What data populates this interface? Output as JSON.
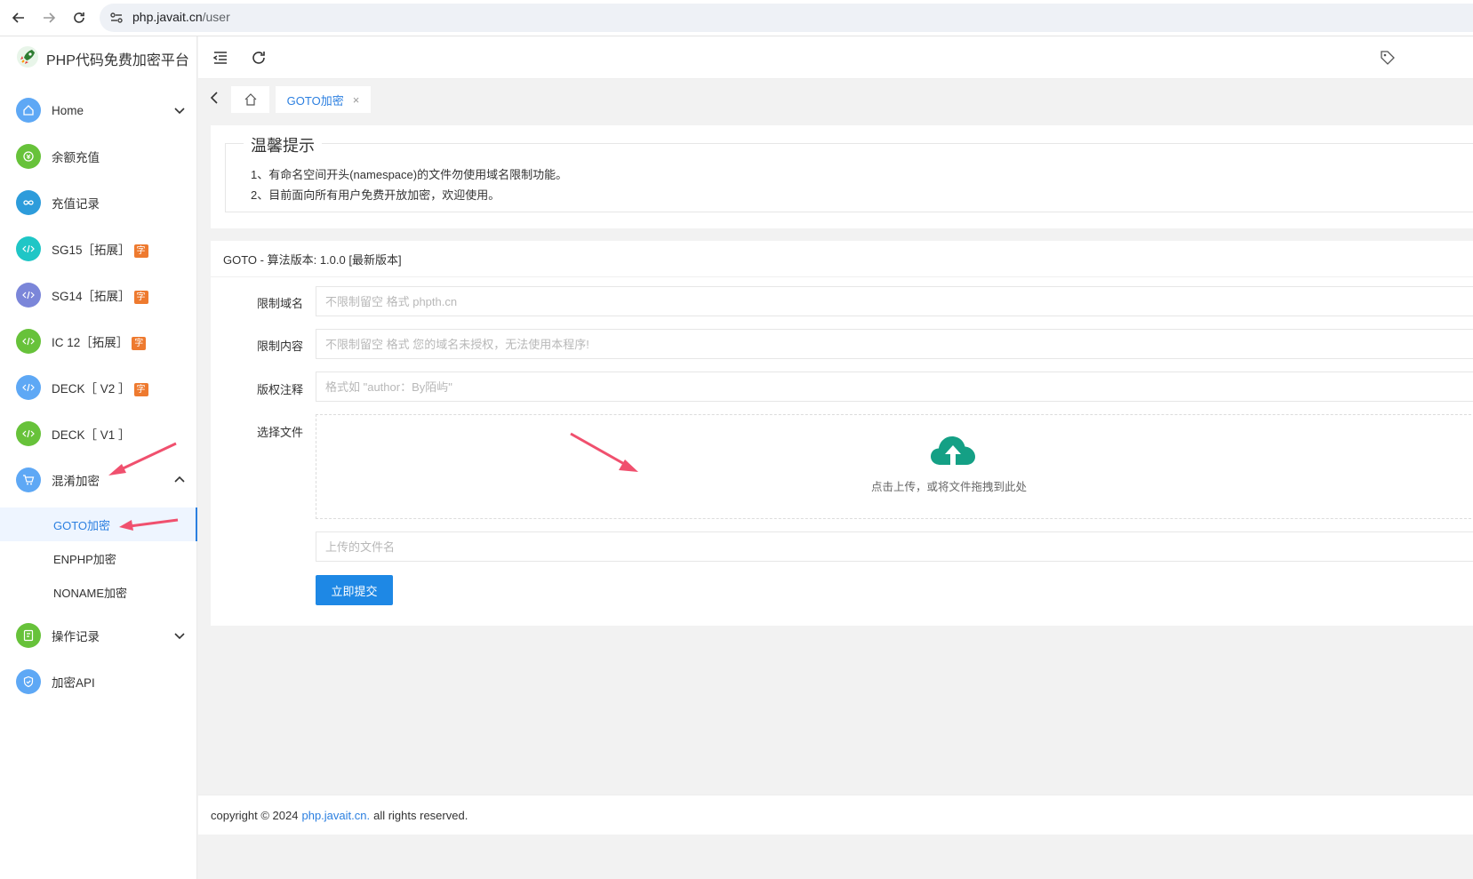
{
  "browser": {
    "url_host": "php.javait.cn",
    "url_path": "/user"
  },
  "sidebar": {
    "logo_text": "PHP代码免费加密平台",
    "items": [
      {
        "label": "Home",
        "icon": "home-icon",
        "color": "#5ea8f5",
        "expandable": true
      },
      {
        "label": "余额充值",
        "icon": "recharge-icon",
        "color": "#67c23a"
      },
      {
        "label": "充值记录",
        "icon": "infinity-icon",
        "color": "#2d9cdb"
      },
      {
        "label": "SG15［拓展］",
        "icon": "code-icon",
        "color": "#1fc6c6",
        "badge": "字"
      },
      {
        "label": "SG14［拓展］",
        "icon": "code-icon",
        "color": "#7b86d9",
        "badge": "字"
      },
      {
        "label": "IC 12［拓展］",
        "icon": "code-icon",
        "color": "#67c23a",
        "badge": "字"
      },
      {
        "label": "DECK［ V2 ］",
        "icon": "code-icon",
        "color": "#5ea8f5",
        "badge": "字"
      },
      {
        "label": "DECK［ V1 ］",
        "icon": "code-icon",
        "color": "#67c23a"
      },
      {
        "label": "混淆加密",
        "icon": "cart-icon",
        "color": "#5ea8f5",
        "expanded": true
      },
      {
        "label": "操作记录",
        "icon": "log-icon",
        "color": "#67c23a",
        "expandable": true
      },
      {
        "label": "加密API",
        "icon": "shield-icon",
        "color": "#5ea8f5"
      }
    ],
    "submenu": [
      {
        "label": "GOTO加密",
        "active": true
      },
      {
        "label": "ENPHP加密"
      },
      {
        "label": "NONAME加密"
      }
    ]
  },
  "tabs": {
    "active_label": "GOTO加密",
    "close_glyph": "×"
  },
  "notice": {
    "title": "温馨提示",
    "lines": [
      "1、有命名空间开头(namespace)的文件勿使用域名限制功能。",
      "2、目前面向所有用户免费开放加密，欢迎使用。"
    ]
  },
  "form": {
    "header": "GOTO - 算法版本: 1.0.0 [最新版本]",
    "domain_label": "限制域名",
    "domain_placeholder": "不限制留空 格式 phpth.cn",
    "content_label": "限制内容",
    "content_placeholder": "不限制留空 格式 您的域名未授权，无法使用本程序!",
    "copyright_label": "版权注释",
    "copyright_placeholder": "格式如 \"author：By陌屿\"",
    "file_label": "选择文件",
    "upload_text": "点击上传，或将文件拖拽到此处",
    "filename_placeholder": "上传的文件名",
    "submit_label": "立即提交"
  },
  "footer": {
    "prefix": "copyright © 2024",
    "link": "php.javait.cn.",
    "suffix": "all rights reserved."
  },
  "colors": {
    "accent": "#1e88e5",
    "upload_icon": "#14a085",
    "annotation_arrow": "#f0506e"
  }
}
